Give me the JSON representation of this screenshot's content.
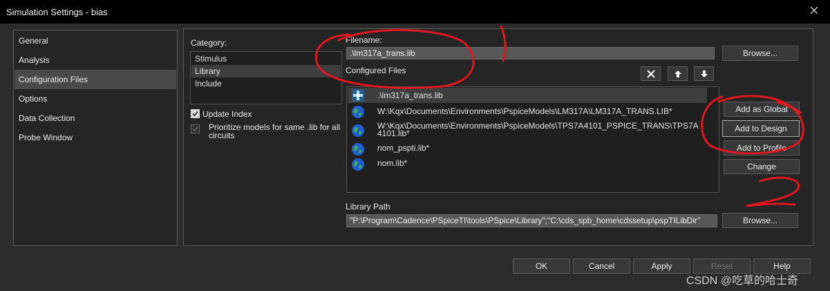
{
  "window": {
    "title": "Simulation Settings - bias"
  },
  "nav": {
    "items": [
      "General",
      "Analysis",
      "Configuration Files",
      "Options",
      "Data Collection",
      "Probe Window"
    ],
    "selected": "Configuration Files"
  },
  "category": {
    "label": "Category:",
    "items": [
      "Stimulus",
      "Library",
      "Include"
    ],
    "selected": "Library"
  },
  "options": {
    "update_index": "Update Index",
    "prioritize_line1": "Prioritize models for same .lib for all",
    "prioritize_line2": "circuits"
  },
  "filename": {
    "label": "Filename:",
    "value": ".\\lm317a_trans.lib"
  },
  "browse_label": "Browse...",
  "configured": {
    "label": "Configured Files",
    "files": [
      {
        "line1": ".\\lm317a_trans.lib",
        "line2": "",
        "icon": "local-file-icon"
      },
      {
        "line1": "W:\\Kqx\\Documents\\Environments\\PspiceModels\\LM317A\\LM317A_TRANS.LIB*",
        "line2": "",
        "icon": "globe-icon"
      },
      {
        "line1": "W:\\Kqx\\Documents\\Environments\\PspiceModels\\TPS7A4101_PSPICE_TRANS\\TPS7A",
        "line2": "4101.lib*",
        "icon": "globe-icon"
      },
      {
        "line1": "nom_pspti.lib*",
        "line2": "",
        "icon": "globe-icon"
      },
      {
        "line1": "nom.lib*",
        "line2": "",
        "icon": "globe-icon"
      }
    ]
  },
  "side_buttons": {
    "add_global": "Add as Global",
    "add_design": "Add to Design",
    "add_profile": "Add to Profile",
    "change": "Change"
  },
  "library_path": {
    "label": "Library Path",
    "value": "\"P:\\Program\\Cadence\\PSpiceTI\\tools\\PSpice\\Library\";\"C:\\cds_spb_home\\cdssetup\\pspTILibDir\""
  },
  "footer": {
    "ok": "OK",
    "cancel": "Cancel",
    "apply": "Apply",
    "reset": "Reset",
    "help": "Help"
  },
  "watermark": "CSDN @吃草的哈士奇",
  "colors": {
    "annotation": "#e0171f",
    "background": "#2b2c2b",
    "titlebar": "#000000"
  }
}
